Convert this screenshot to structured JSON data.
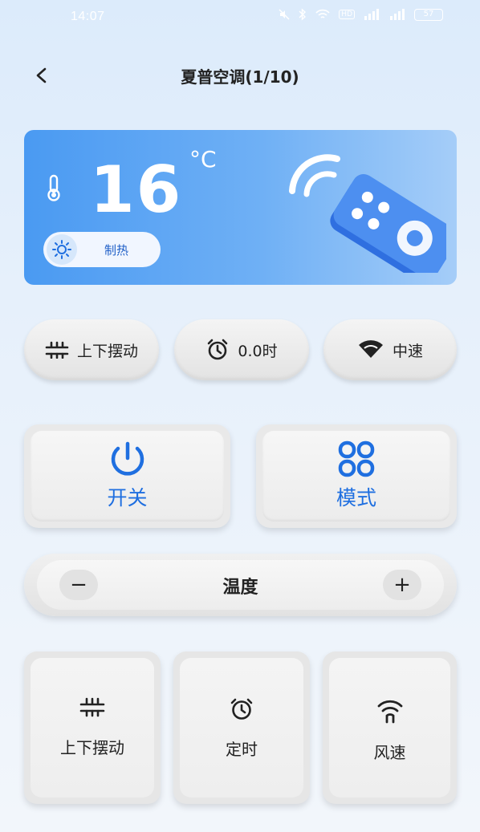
{
  "status_bar": {
    "time": "14:07",
    "battery": "57",
    "hd_label": "HD"
  },
  "header": {
    "title": "夏普空调(1/10)"
  },
  "hero": {
    "temperature": "16",
    "unit": "°C",
    "mode_label": "制热"
  },
  "chips": [
    {
      "label": "上下摆动",
      "icon": "swing-icon"
    },
    {
      "label": "0.0时",
      "icon": "alarm-clock-icon"
    },
    {
      "label": "中速",
      "icon": "wifi-fan-speed-icon"
    }
  ],
  "main_buttons": {
    "power_label": "开关",
    "mode_label": "模式"
  },
  "temperature_bar": {
    "label": "温度",
    "minus": "−",
    "plus": "+"
  },
  "cards": [
    {
      "label": "上下摆动",
      "icon": "swing-icon"
    },
    {
      "label": "定时",
      "icon": "alarm-clock-icon"
    },
    {
      "label": "风速",
      "icon": "signal-fan-icon"
    }
  ],
  "colors": {
    "accent": "#1f6fe0",
    "hero_start": "#4a9af2",
    "hero_end": "#a5cdf8"
  }
}
